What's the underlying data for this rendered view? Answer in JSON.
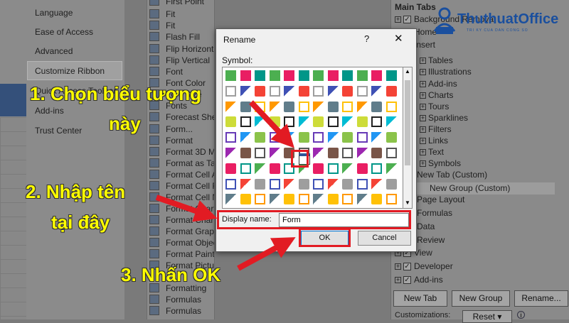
{
  "categories": [
    "Language",
    "Ease of Access",
    "Advanced",
    "Customize Ribbon",
    "Quick Access Toolbar",
    "Add-ins",
    "Trust Center"
  ],
  "commands": [
    "First Point",
    "Fit",
    "Fit",
    "Flash Fill",
    "Flip Horizontal",
    "Flip Vertical",
    "Font",
    "Font Color",
    "Font Size",
    "Fonts",
    "Forecast Sheet",
    "Form...",
    "Format",
    "Format 3D Model",
    "Format as Table",
    "Format Cell Alignment",
    "Format Cell Font",
    "Format Cell Number",
    "Format Chart",
    "Format Chart Area",
    "Format Graphic",
    "Format Object",
    "Format Painter",
    "Format Picture",
    "Formatting",
    "Formulas",
    "Formulas"
  ],
  "tabs": {
    "header": "Main Tabs",
    "items": [
      "Background Removal",
      "Home",
      "Insert",
      "Tables",
      "Illustrations",
      "Add-ins",
      "Charts",
      "Tours",
      "Sparklines",
      "Filters",
      "Links",
      "Text",
      "Symbols",
      "New Tab (Custom)",
      "New Group (Custom)",
      "Page Layout",
      "Formulas",
      "Data",
      "Review",
      "View",
      "Developer",
      "Add-ins"
    ],
    "new_tab": "New Tab",
    "new_group": "New Group",
    "rename": "Rename...",
    "customizations": "Customizations:",
    "reset": "Reset",
    "check": "✓",
    "plus": "+",
    "minus": "−"
  },
  "dialog": {
    "title": "Rename",
    "help": "?",
    "close": "✕",
    "symbol_label": "Symbol:",
    "display_name_label": "Display name:",
    "display_name_value": "Form",
    "ok": "OK",
    "cancel": "Cancel"
  },
  "annotations": {
    "step1_line1": "1. Chọn biểu tượng",
    "step1_line2": "này",
    "step2_line1": "2. Nhập tên",
    "step2_line2": "tại đây",
    "step3": "3. Nhấn OK"
  },
  "logo": {
    "name": "ThuthuatOffice",
    "tagline": "TRI KY CUA DAN CONG SO"
  },
  "colors": {
    "highlight": "#e21b23",
    "annotation": "#ffff00",
    "logo": "#1a4f9e"
  }
}
